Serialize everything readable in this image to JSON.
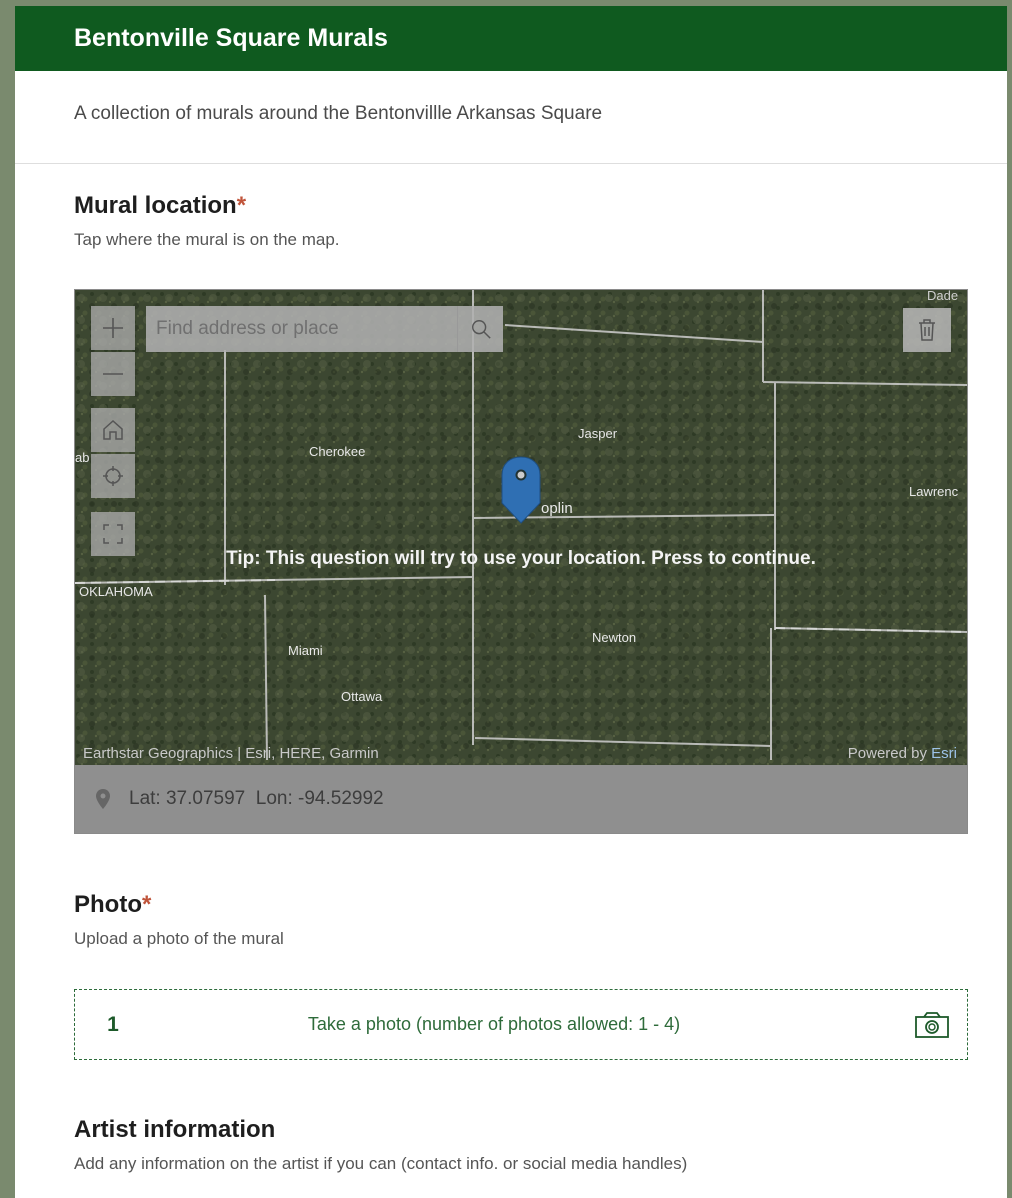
{
  "header": {
    "title": "Bentonville Square Murals"
  },
  "description": "A collection of murals around the Bentonvillle Arkansas Square",
  "mural_location": {
    "title": "Mural location",
    "required_mark": "*",
    "hint": "Tap where the mural is on the map.",
    "map": {
      "search_placeholder": "Find address or place",
      "tip": "Tip: This question will try to use your location. Press to continue.",
      "attribution": "Earthstar Geographics | Esri, HERE, Garmin",
      "powered_by": "Powered by",
      "esri": "Esri",
      "coordinates": "Lat: 37.07597  Lon: -94.52992",
      "places": {
        "jasper": "Jasper",
        "cherokee": "Cherokee",
        "joplin": "oplin",
        "lawrence": "Lawrenc",
        "oklahoma": "OKLAHOMA",
        "newton": "Newton",
        "miami": "Miami",
        "ottawa": "Ottawa",
        "dade": "Dade",
        "left_edge": "ab"
      }
    }
  },
  "photo": {
    "title": "Photo",
    "required_mark": "*",
    "hint": "Upload a photo of the mural",
    "count": "1",
    "upload_text": "Take a photo (number of photos allowed: 1 - 4)"
  },
  "artist": {
    "title": "Artist information",
    "hint": "Add any information on the artist if you can (contact info. or social media handles)"
  },
  "colors": {
    "header_bg": "#0f5a1f",
    "accent": "#1d5a2a",
    "required": "#c0543a",
    "pin": "#2f6fb3"
  },
  "icons": [
    "plus-icon",
    "minus-icon",
    "home-icon",
    "locate-icon",
    "fullscreen-icon",
    "search-icon",
    "trash-icon",
    "map-pin-icon",
    "location-marker-icon",
    "camera-icon"
  ]
}
